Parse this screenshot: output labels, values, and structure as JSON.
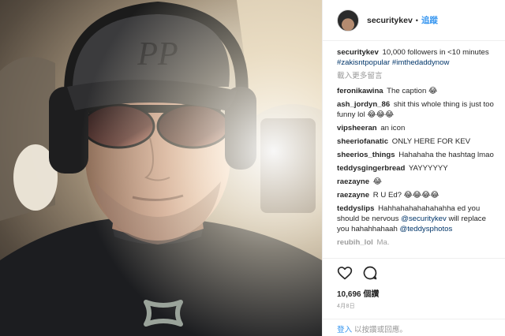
{
  "header": {
    "username": "securitykev",
    "separator": "•",
    "follow_label": "追蹤"
  },
  "caption": {
    "username": "securitykev",
    "text": "10,000 followers in <10 minutes",
    "hashtags": "#zakisntpopular #imthedaddynow"
  },
  "load_more_label": "載入更多留言",
  "comments": [
    {
      "user": "feronikawina",
      "text": "The caption 😂"
    },
    {
      "user": "ash_jordyn_86",
      "text": "shit this whole thing is just too funny lol 😂😂😂"
    },
    {
      "user": "vipsheeran",
      "text": "an icon"
    },
    {
      "user": "sheeriofanatic",
      "text": "ONLY HERE FOR KEV"
    },
    {
      "user": "sheerios_things",
      "text": "Hahahaha the hashtag lmao"
    },
    {
      "user": "teddysgingerbread",
      "text": "YAYYYYYY"
    },
    {
      "user": "raezayne",
      "text": "😂"
    },
    {
      "user": "raezayne",
      "text": "R U Ed? 😂😂😂😂"
    },
    {
      "user": "teddyslips",
      "text": "Hahhahahahahahahha ed you should be nervous",
      "mention1": "@securitykev",
      "text2": "will replace you hahahhahaah",
      "mention2": "@teddysphotos"
    }
  ],
  "partial_comment": {
    "user": "reubih_lol",
    "text": "Ma."
  },
  "likes": "10,696 個讚",
  "date": "4月8日",
  "footer": {
    "login_label": "登入",
    "suffix": "以按讚或回應。"
  },
  "icons": {
    "like": "heart-icon",
    "comment": "comment-icon",
    "logo": "under-armour-logo"
  },
  "colors": {
    "accent": "#3897f0",
    "hashtag": "#003569",
    "muted": "#999999"
  }
}
